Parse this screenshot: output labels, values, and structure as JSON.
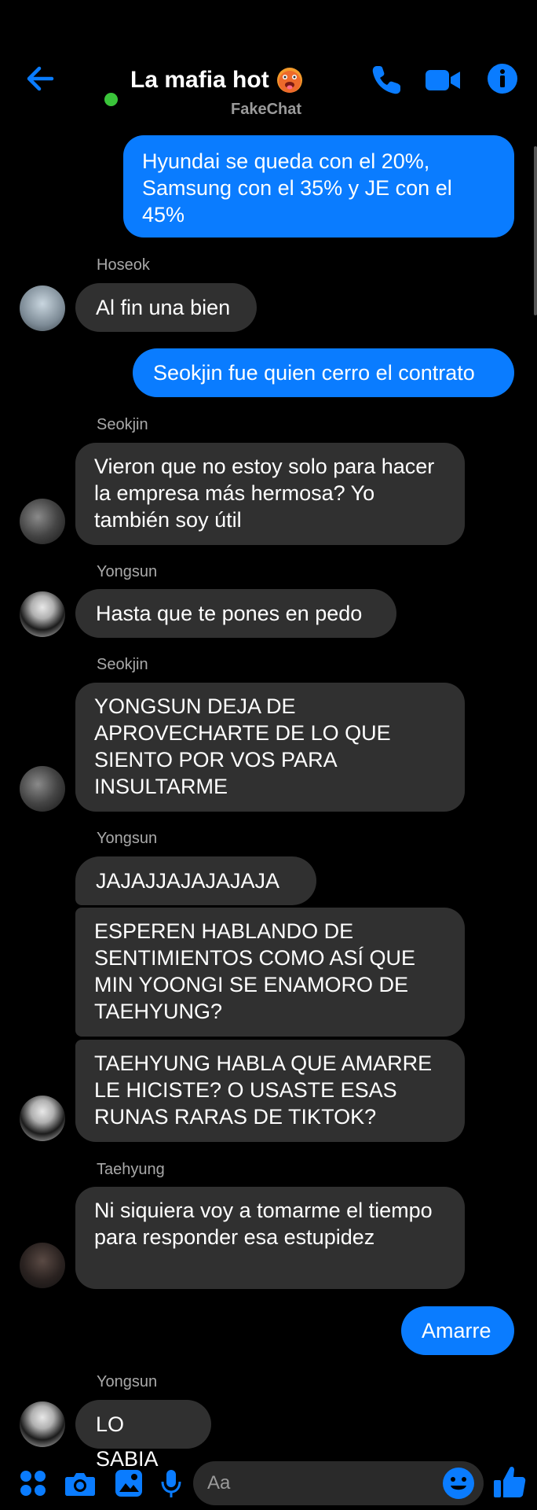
{
  "header": {
    "title": "La mafia hot",
    "subtitle": "FakeChat",
    "emoji_icon": "hot-face-emoji-icon"
  },
  "messages": {
    "m1": "Hyundai se queda con el 20%, Samsung con el 35% y JE con el 45%",
    "s2": "Hoseok",
    "m2": "Al fin una bien",
    "m3": "Seokjin fue quien cerro el contrato",
    "s4": "Seokjin",
    "m4": "Vieron que no estoy solo para hacer la empresa más hermosa? Yo también soy útil",
    "s5": "Yongsun",
    "m5": "Hasta que te pones en pedo",
    "s6": "Seokjin",
    "m6": "YONGSUN DEJA DE APROVECHARTE DE LO QUE SIENTO POR VOS PARA INSULTARME",
    "s7": "Yongsun",
    "m7a": "JAJAJJAJAJAJAJA",
    "m7b": "ESPEREN HABLANDO DE SENTIMIENTOS COMO ASÍ QUE MIN YOONGI SE ENAMORO DE TAEHYUNG?",
    "m7c": "TAEHYUNG HABLA QUE AMARRE LE HICISTE? O USASTE ESAS RUNAS RARAS DE TIKTOK?",
    "s8": "Taehyung",
    "m8": "Ni siquiera voy a tomarme el tiempo para responder esa estupidez",
    "m9": "Amarre",
    "s10": "Yongsun",
    "m10": "LO SABIA"
  },
  "composer": {
    "placeholder": "Aa"
  },
  "colors": {
    "accent": "#0a7cff",
    "incoming_bubble": "#303030",
    "online": "#3ac43a"
  }
}
